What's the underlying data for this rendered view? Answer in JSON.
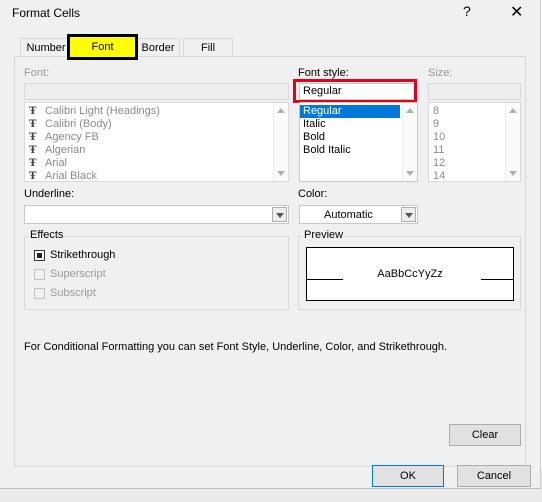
{
  "window": {
    "title": "Format Cells",
    "help_label": "?",
    "close_label": "✕"
  },
  "tabs": [
    {
      "label": "Number"
    },
    {
      "label": "Font",
      "active": true
    },
    {
      "label": "Border"
    },
    {
      "label": "Fill"
    }
  ],
  "font": {
    "label": "Font:",
    "value": "",
    "items": [
      {
        "glyph": "Ŧ",
        "label": "Calibri Light (Headings)"
      },
      {
        "glyph": "Ŧ",
        "label": "Calibri (Body)"
      },
      {
        "glyph": "Ŧ",
        "label": "Agency FB"
      },
      {
        "glyph": "Ŧ",
        "label": "Algerian"
      },
      {
        "glyph": "Ŧ",
        "label": "Arial"
      },
      {
        "glyph": "Ŧ",
        "label": "Arial Black"
      }
    ]
  },
  "font_style": {
    "label": "Font style:",
    "value": "Regular",
    "items": [
      "Regular",
      "Italic",
      "Bold",
      "Bold Italic"
    ],
    "selected": "Regular"
  },
  "size": {
    "label": "Size:",
    "value": "",
    "items": [
      "8",
      "9",
      "10",
      "11",
      "12",
      "14"
    ]
  },
  "underline": {
    "label": "Underline:",
    "value": ""
  },
  "color": {
    "label": "Color:",
    "value": "Automatic"
  },
  "effects": {
    "label": "Effects",
    "strikethrough": {
      "label": "Strikethrough",
      "checked": true,
      "enabled": true
    },
    "superscript": {
      "label": "Superscript",
      "checked": false,
      "enabled": false
    },
    "subscript": {
      "label": "Subscript",
      "checked": false,
      "enabled": false
    }
  },
  "preview": {
    "label": "Preview",
    "sample": "AaBbCcYyZz"
  },
  "info_text": "For Conditional Formatting you can set Font Style, Underline, Color, and Strikethrough.",
  "buttons": {
    "clear": "Clear",
    "ok": "OK",
    "cancel": "Cancel"
  },
  "colors": {
    "highlight_tab": "#ffff00",
    "annotation_red": "#e3001b",
    "selection_blue": "#0078d7",
    "dialog_bg": "#f0f0f0"
  }
}
